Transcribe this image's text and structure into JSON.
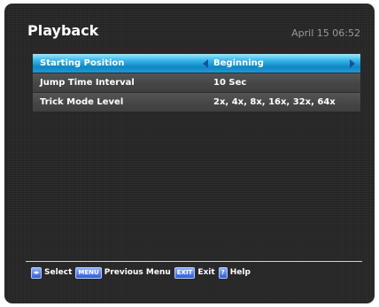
{
  "header": {
    "title": "Playback",
    "datetime": "April 15 06:52"
  },
  "menu": {
    "items": [
      {
        "label": "Starting Position",
        "value": "Beginning",
        "selected": true
      },
      {
        "label": "Jump Time Interval",
        "value": "10 Sec",
        "selected": false
      },
      {
        "label": "Trick Mode Level",
        "value": "2x, 4x, 8x, 16x, 32x, 64x",
        "selected": false
      }
    ]
  },
  "footer": {
    "keys": [
      {
        "icon": "left-right-arrows-icon",
        "key": "◂▸",
        "label": "Select"
      },
      {
        "icon": "menu-key-icon",
        "key": "MENU",
        "label": "Previous Menu"
      },
      {
        "icon": "exit-key-icon",
        "key": "EXIT",
        "label": "Exit"
      },
      {
        "icon": "help-key-icon",
        "key": "?",
        "label": "Help"
      }
    ]
  },
  "colors": {
    "background": "#262626",
    "selected_row": "#1e9ad6",
    "row": "#4a4a4a",
    "arrow": "#1b4f9a",
    "key": "#2e5bd6"
  }
}
